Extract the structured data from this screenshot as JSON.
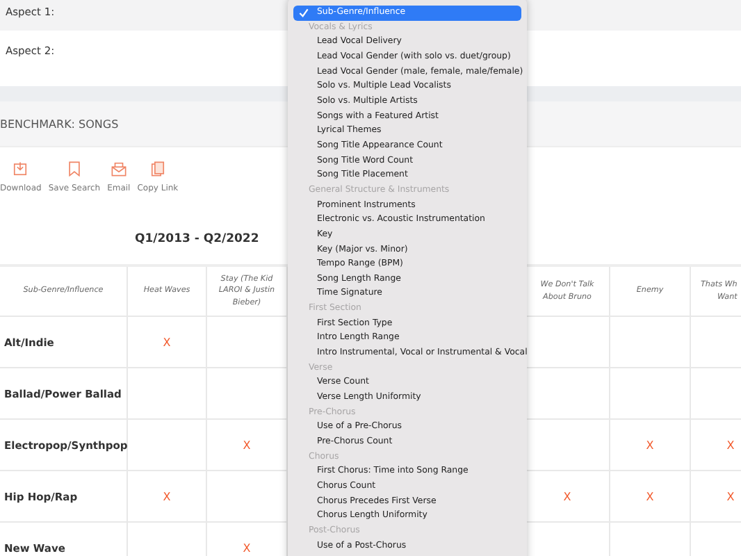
{
  "aspects": [
    {
      "label": "Aspect 1:"
    },
    {
      "label": "Aspect 2:"
    }
  ],
  "section_title": "BENCHMARK: SONGS",
  "toolbar": [
    {
      "kind": "download",
      "label": "Download"
    },
    {
      "kind": "bookmark",
      "label": "Save Search"
    },
    {
      "kind": "email",
      "label": "Email"
    },
    {
      "kind": "copy",
      "label": "Copy Link"
    }
  ],
  "period": "Q1/2013 - Q2/2022",
  "table": {
    "corner": "Sub-Genre/Influence",
    "columns": [
      "Heat Waves",
      "Stay (The Kid LAROI & Justin Bieber)",
      "We Don't Talk About Bruno",
      "Enemy",
      "Thats Wh\nWant"
    ],
    "rows": [
      {
        "label": "Alt/Indie",
        "cells": [
          "X",
          null,
          null,
          null,
          null
        ]
      },
      {
        "label": "Ballad/Power Ballad",
        "cells": [
          null,
          null,
          null,
          null,
          null
        ]
      },
      {
        "label": "Electropop/Synthpop",
        "cells": [
          null,
          "X",
          null,
          "X",
          "X"
        ]
      },
      {
        "label": "Hip Hop/Rap",
        "cells": [
          "X",
          null,
          "X",
          "X",
          "X"
        ]
      },
      {
        "label": "New Wave",
        "cells": [
          null,
          "X",
          null,
          null,
          null
        ]
      }
    ]
  },
  "menu": {
    "items": [
      {
        "kind": "option",
        "label": "Sub-Genre/Influence",
        "selected": true
      },
      {
        "kind": "header",
        "label": "Vocals & Lyrics"
      },
      {
        "kind": "option",
        "label": "Lead Vocal Delivery",
        "selected": false
      },
      {
        "kind": "option",
        "label": "Lead Vocal Gender (with solo vs. duet/group)",
        "selected": false
      },
      {
        "kind": "option",
        "label": "Lead Vocal Gender (male, female, male/female)",
        "selected": false
      },
      {
        "kind": "option",
        "label": "Solo vs. Multiple Lead Vocalists",
        "selected": false
      },
      {
        "kind": "option",
        "label": "Solo vs. Multiple Artists",
        "selected": false
      },
      {
        "kind": "option",
        "label": "Songs with a Featured Artist",
        "selected": false
      },
      {
        "kind": "option",
        "label": "Lyrical Themes",
        "selected": false
      },
      {
        "kind": "option",
        "label": "Song Title Appearance Count",
        "selected": false
      },
      {
        "kind": "option",
        "label": "Song Title Word Count",
        "selected": false
      },
      {
        "kind": "option",
        "label": "Song Title Placement",
        "selected": false
      },
      {
        "kind": "header",
        "label": "General Structure & Instruments"
      },
      {
        "kind": "option",
        "label": "Prominent Instruments",
        "selected": false
      },
      {
        "kind": "option",
        "label": "Electronic vs. Acoustic Instrumentation",
        "selected": false
      },
      {
        "kind": "option",
        "label": "Key",
        "selected": false
      },
      {
        "kind": "option",
        "label": "Key (Major vs. Minor)",
        "selected": false
      },
      {
        "kind": "option",
        "label": "Tempo Range (BPM)",
        "selected": false
      },
      {
        "kind": "option",
        "label": "Song Length Range",
        "selected": false
      },
      {
        "kind": "option",
        "label": "Time Signature",
        "selected": false
      },
      {
        "kind": "header",
        "label": "First Section"
      },
      {
        "kind": "option",
        "label": "First Section Type",
        "selected": false
      },
      {
        "kind": "option",
        "label": "Intro Length Range",
        "selected": false
      },
      {
        "kind": "option",
        "label": "Intro Instrumental, Vocal or Instrumental & Vocal",
        "selected": false
      },
      {
        "kind": "header",
        "label": "Verse"
      },
      {
        "kind": "option",
        "label": "Verse Count",
        "selected": false
      },
      {
        "kind": "option",
        "label": "Verse Length Uniformity",
        "selected": false
      },
      {
        "kind": "header",
        "label": "Pre-Chorus"
      },
      {
        "kind": "option",
        "label": "Use of a Pre-Chorus",
        "selected": false
      },
      {
        "kind": "option",
        "label": "Pre-Chorus Count",
        "selected": false
      },
      {
        "kind": "header",
        "label": "Chorus"
      },
      {
        "kind": "option",
        "label": "First Chorus: Time into Song Range",
        "selected": false
      },
      {
        "kind": "option",
        "label": "Chorus Count",
        "selected": false
      },
      {
        "kind": "option",
        "label": "Chorus Precedes First Verse",
        "selected": false
      },
      {
        "kind": "option",
        "label": "Chorus Length Uniformity",
        "selected": false
      },
      {
        "kind": "header",
        "label": "Post-Chorus"
      },
      {
        "kind": "option",
        "label": "Use of a Post-Chorus",
        "selected": false
      }
    ]
  }
}
